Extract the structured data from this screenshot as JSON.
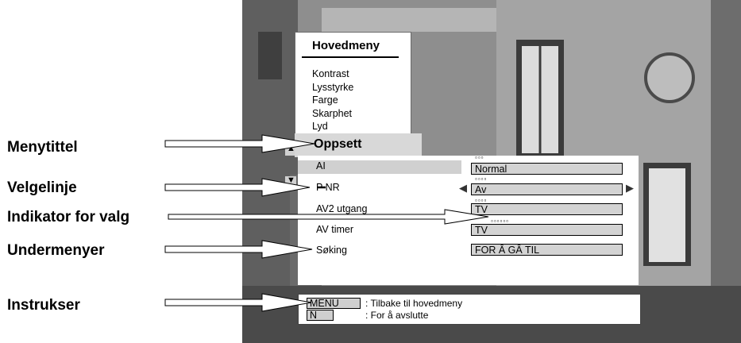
{
  "callouts": {
    "menytittel": "Menytittel",
    "velgelinje": "Velgelinje",
    "indikator": "Indikator for valg",
    "undermenyer": "Undermenyer",
    "instrukser": "Instrukser"
  },
  "main_menu": {
    "title": "Hovedmeny",
    "items": [
      "Kontrast",
      "Lysstyrke",
      "Farge",
      "Skarphet",
      "Lyd"
    ]
  },
  "submenu": {
    "title": "Oppsett",
    "rows": [
      {
        "label": "AI",
        "value": "Normal",
        "indicator": "▫▫▫"
      },
      {
        "label": "P NR",
        "value": "Av",
        "indicator": "▫▫▫▫"
      },
      {
        "label": "AV2 utgang",
        "value": "TV",
        "indicator": "▫▫▫▫"
      },
      {
        "label": "AV timer",
        "value": "TV",
        "indicator": "▫▫▫▫▫▫"
      },
      {
        "label": "Søking",
        "value": "FOR Â GÂ TIL",
        "indicator": ""
      }
    ],
    "arrow_left": "◀",
    "arrow_right": "▶",
    "scroll_up": "▲",
    "scroll_down": "▼"
  },
  "instructions": [
    {
      "key": "MENU",
      "text": ": Tilbake til hovedmeny"
    },
    {
      "key": "N",
      "text": ": For å avslutte"
    }
  ],
  "colors": {
    "panel": "#ffffff",
    "highlight": "#d0d0d0",
    "photo": "#8a8a8a"
  }
}
